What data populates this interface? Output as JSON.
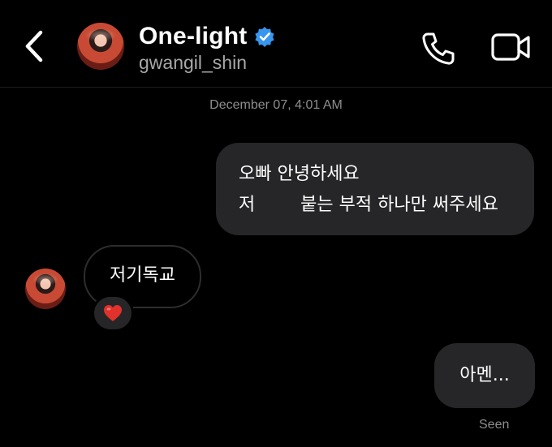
{
  "header": {
    "back_icon": "chevron-left-icon",
    "name": "One-light",
    "verified_icon": "verified-badge-icon",
    "username": "gwangil_shin",
    "call_icon": "phone-icon",
    "video_icon": "video-camera-icon"
  },
  "thread": {
    "timestamp": "December 07, 4:01 AM",
    "messages": [
      {
        "direction": "outgoing",
        "lines": [
          "오빠 안녕하세요",
          "저        붙는 부적 하나만 써주세요"
        ]
      },
      {
        "direction": "incoming",
        "text": "저기독교",
        "reaction": "❤️"
      },
      {
        "direction": "outgoing",
        "text": "아멘..."
      }
    ],
    "status": "Seen"
  },
  "colors": {
    "background": "#000000",
    "bubble": "#262628",
    "muted_text": "#8e8e8e",
    "verified_blue": "#3797f0",
    "reaction_heart": "#e0322b"
  }
}
